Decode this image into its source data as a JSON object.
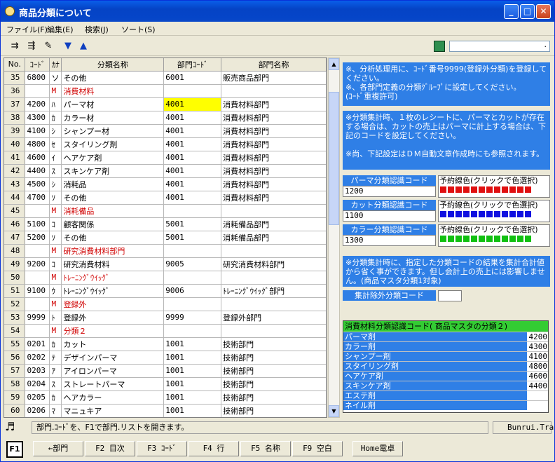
{
  "window": {
    "title": "商品分類について",
    "min": "_",
    "max": "□",
    "close": "✕"
  },
  "menu": [
    "ファイル(F)",
    "編集(E)",
    "検索(J)",
    "ソート(S)"
  ],
  "topinput": ".",
  "columns": [
    "No.",
    "ｺｰﾄﾞ",
    "ｶﾅ",
    "分類名称",
    "部門ｺｰﾄﾞ",
    "部門名称"
  ],
  "rows": [
    {
      "no": "35",
      "code": "6800",
      "kana": "ソ",
      "name": "その他",
      "dcode": "6001",
      "dname": "販売商品部門",
      "red": false
    },
    {
      "no": "36",
      "code": "",
      "kana": "M",
      "name": "消費材料",
      "dcode": "",
      "dname": "",
      "red": true
    },
    {
      "no": "37",
      "code": "4200",
      "kana": "ﾊ",
      "name": "パーマ材",
      "dcode": "4001",
      "dname": "消費材料部門",
      "red": false,
      "hl": true
    },
    {
      "no": "38",
      "code": "4300",
      "kana": "ｶ",
      "name": "カラー材",
      "dcode": "4001",
      "dname": "消費材料部門",
      "red": false
    },
    {
      "no": "39",
      "code": "4100",
      "kana": "ｼ",
      "name": "シャンプー材",
      "dcode": "4001",
      "dname": "消費材料部門",
      "red": false
    },
    {
      "no": "40",
      "code": "4800",
      "kana": "ｾ",
      "name": "スタイリング剤",
      "dcode": "4001",
      "dname": "消費材料部門",
      "red": false
    },
    {
      "no": "41",
      "code": "4600",
      "kana": "ｲ",
      "name": "ヘアケア剤",
      "dcode": "4001",
      "dname": "消費材料部門",
      "red": false
    },
    {
      "no": "42",
      "code": "4400",
      "kana": "ｽ",
      "name": "スキンケア剤",
      "dcode": "4001",
      "dname": "消費材料部門",
      "red": false
    },
    {
      "no": "43",
      "code": "4500",
      "kana": "ｼ",
      "name": "消耗品",
      "dcode": "4001",
      "dname": "消費材料部門",
      "red": false
    },
    {
      "no": "44",
      "code": "4700",
      "kana": "ｿ",
      "name": "その他",
      "dcode": "4001",
      "dname": "消費材料部門",
      "red": false
    },
    {
      "no": "45",
      "code": "",
      "kana": "M",
      "name": "消耗備品",
      "dcode": "",
      "dname": "",
      "red": true
    },
    {
      "no": "46",
      "code": "5100",
      "kana": "ｺ",
      "name": "顧客関係",
      "dcode": "5001",
      "dname": "消耗備品部門",
      "red": false
    },
    {
      "no": "47",
      "code": "5200",
      "kana": "ｿ",
      "name": "その他",
      "dcode": "5001",
      "dname": "消耗備品部門",
      "red": false
    },
    {
      "no": "48",
      "code": "",
      "kana": "M",
      "name": "研究消費材料部門",
      "dcode": "",
      "dname": "",
      "red": true
    },
    {
      "no": "49",
      "code": "9200",
      "kana": "ｺ",
      "name": "研究消費材料",
      "dcode": "9005",
      "dname": "研究消費材料部門",
      "red": false
    },
    {
      "no": "50",
      "code": "",
      "kana": "M",
      "name": "ﾄﾚｰﾆﾝｸﾞｳｲｯｸﾞ",
      "dcode": "",
      "dname": "",
      "red": true
    },
    {
      "no": "51",
      "code": "9100",
      "kana": "ｳ",
      "name": "ﾄﾚｰﾆﾝｸﾞｳｲｯｸﾞ",
      "dcode": "9006",
      "dname": "ﾄﾚｰﾆﾝｸﾞｳｲｯｸﾞ部門",
      "red": false
    },
    {
      "no": "52",
      "code": "",
      "kana": "M",
      "name": "登録外",
      "dcode": "",
      "dname": "",
      "red": true
    },
    {
      "no": "53",
      "code": "9999",
      "kana": "ﾄ",
      "name": "登録外",
      "dcode": "9999",
      "dname": "登録外部門",
      "red": false
    },
    {
      "no": "54",
      "code": "",
      "kana": "M",
      "name": "分類２",
      "dcode": "",
      "dname": "",
      "red": true
    },
    {
      "no": "55",
      "code": "0201",
      "kana": "ｶ",
      "name": "カット",
      "dcode": "1001",
      "dname": "技術部門",
      "red": false
    },
    {
      "no": "56",
      "code": "0202",
      "kana": "ﾃ",
      "name": "デザインパーマ",
      "dcode": "1001",
      "dname": "技術部門",
      "red": false
    },
    {
      "no": "57",
      "code": "0203",
      "kana": "ｱ",
      "name": "アイロンパーマ",
      "dcode": "1001",
      "dname": "技術部門",
      "red": false
    },
    {
      "no": "58",
      "code": "0204",
      "kana": "ｽ",
      "name": "ストレートパーマ",
      "dcode": "1001",
      "dname": "技術部門",
      "red": false
    },
    {
      "no": "59",
      "code": "0205",
      "kana": "ｶ",
      "name": "ヘアカラー",
      "dcode": "1001",
      "dname": "技術部門",
      "red": false
    },
    {
      "no": "60",
      "code": "0206",
      "kana": "ﾏ",
      "name": "マニュキア",
      "dcode": "1001",
      "dname": "技術部門",
      "red": false
    }
  ],
  "info1": "※、分析処理用に、ｺｰﾄﾞ番号9999(登録外分類)を登録してください。\n※、各部門定義の分類ｸﾞﾙｰﾌﾟに設定してください。\n(ｺｰﾄﾞ重複許可)",
  "info2": "※分類集計時、１枚のレシートに、パーマとカットが存在する場合は、カットの売上はパーマに計上する場合は、下記のコードを設定してください。\n\n※尚、下記設定はＤＭ自動文章作成時にも参照されます。",
  "perm_label": "パーマ分類認識コード",
  "perm_value": "1200",
  "cut_label": "カット分類認識コード",
  "cut_value": "1100",
  "color_label": "カラー分類認識コード",
  "color_value": "1300",
  "pick_label": "予約線色(クリックで色選択)",
  "pick_colors": [
    "#e01010",
    "#1010e0",
    "#10c010"
  ],
  "info3": "※分類集計時に、指定した分類コードの結果を集計合計値から省く事ができます。但し会計上の売上には影響しません。(商品マスタ分類1対象)",
  "exclude_label": "集計除外分類コード",
  "exclude_value": "",
  "cat_head": "消費材料分類認識コード( 商品マスタの分類２)",
  "cat_rows": [
    {
      "name": "パーマ剤",
      "value": "4200"
    },
    {
      "name": "カラー剤",
      "value": "4300"
    },
    {
      "name": "シャンプー剤",
      "value": "4100"
    },
    {
      "name": "スタイリング剤",
      "value": "4800"
    },
    {
      "name": "ヘアケア剤",
      "value": "4600"
    },
    {
      "name": "スキンケア剤",
      "value": "4400"
    },
    {
      "name": "エステ剤",
      "value": ""
    },
    {
      "name": "ネイル剤",
      "value": ""
    }
  ],
  "status_text": "部門.ｺｰﾄﾞを、F1で部門.リストを開きます。",
  "status_file": "Bunrui.Tra",
  "fkeys": [
    "←部門",
    "F2 目次",
    "F3 ｺｰﾄﾞ",
    "F4 行",
    "F5 名称",
    "F9 空白",
    "Home電卓"
  ],
  "f1": "F1"
}
